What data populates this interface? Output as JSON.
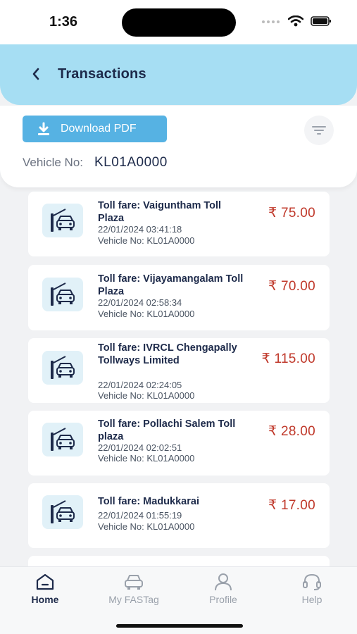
{
  "status": {
    "time": "1:36"
  },
  "header": {
    "title": "Transactions"
  },
  "actions": {
    "download_label": "Download PDF"
  },
  "vehicle": {
    "label": "Vehicle No:",
    "value": "KL01A0000"
  },
  "transactions": [
    {
      "title": "Toll fare: Vaiguntham Toll Plaza",
      "datetime": "22/01/2024 03:41:18",
      "vehicle": "Vehicle No: KL01A0000",
      "amount": "₹ 75.00"
    },
    {
      "title": "Toll fare: Vijayamangalam Toll Plaza",
      "datetime": "22/01/2024 02:58:34",
      "vehicle": "Vehicle No: KL01A0000",
      "amount": "₹ 70.00"
    },
    {
      "title": "Toll fare: IVRCL Chengapally Tollways Limited",
      "datetime": "22/01/2024 02:24:05",
      "vehicle": "Vehicle No: KL01A0000",
      "amount": "₹ 115.00"
    },
    {
      "title": "Toll fare: Pollachi Salem Toll plaza",
      "datetime": "22/01/2024 02:02:51",
      "vehicle": "Vehicle No: KL01A0000",
      "amount": "₹ 28.00"
    },
    {
      "title": "Toll fare: Madukkarai",
      "datetime": "22/01/2024 01:55:19",
      "vehicle": "Vehicle No: KL01A0000",
      "amount": "₹ 17.00"
    }
  ],
  "tabs": [
    {
      "label": "Home",
      "icon": "home-icon",
      "active": true
    },
    {
      "label": "My FASTag",
      "icon": "car-icon",
      "active": false
    },
    {
      "label": "Profile",
      "icon": "profile-icon",
      "active": false
    },
    {
      "label": "Help",
      "icon": "headset-icon",
      "active": false
    }
  ],
  "colors": {
    "header_bg": "#a6def3",
    "button_bg": "#56b2e3",
    "amount": "#c0392b",
    "icon_bg": "#e1f1f8"
  }
}
